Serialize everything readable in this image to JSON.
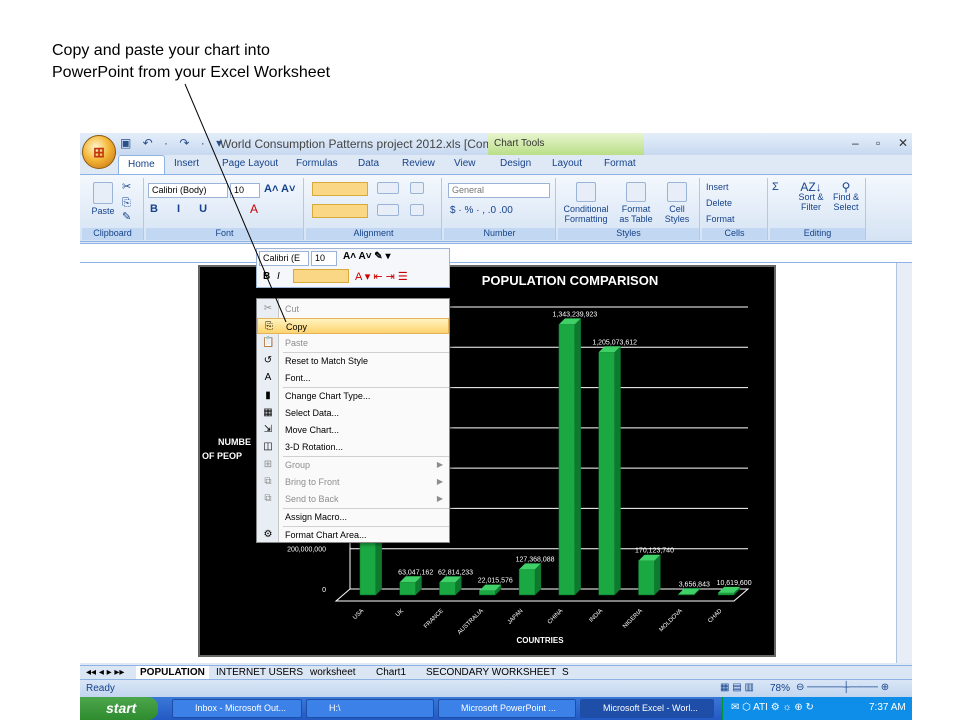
{
  "caption": {
    "line1": "Copy and paste your chart into",
    "line2": "PowerPoint from your Excel Worksheet"
  },
  "title": {
    "qat": "▣ ↶ · ↷ · ▾",
    "window": "World Consumption Patterns project 2012.xls  [Comp...",
    "chart_tools": "Chart Tools",
    "controls": [
      "–",
      "▫",
      "✕"
    ]
  },
  "tabs": [
    "Home",
    "Insert",
    "Page Layout",
    "Formulas",
    "Data",
    "Review",
    "View",
    "Design",
    "Layout",
    "Format"
  ],
  "ribbon": {
    "clipboard": {
      "label": "Clipboard",
      "paste": "Paste"
    },
    "font": {
      "label": "Font",
      "name": "Calibri (Body)",
      "size": "10"
    },
    "alignment": {
      "label": "Alignment"
    },
    "number": {
      "label": "Number",
      "format": "General",
      "symbols": "$ · % · ,  .0 .00"
    },
    "styles": {
      "label": "Styles",
      "conditional": "Conditional Formatting",
      "format_table": "Format as Table",
      "cell_styles": "Cell Styles"
    },
    "cells": {
      "label": "Cells",
      "insert": "Insert",
      "delete": "Delete",
      "format": "Format"
    },
    "editing": {
      "label": "Editing",
      "sort": "Sort & Filter",
      "find": "Find & Select"
    }
  },
  "mini_toolbar": {
    "font": "Calibri (E",
    "size": "10",
    "bold": "B",
    "italic": "I"
  },
  "context_menu": [
    {
      "label": "Cut",
      "icon": "✂",
      "state": "disabled"
    },
    {
      "label": "Copy",
      "icon": "⎘",
      "state": "highlight"
    },
    {
      "label": "Paste",
      "icon": "📋",
      "state": "disabled"
    },
    {
      "label": "Reset to Match Style",
      "icon": "↺",
      "state": ""
    },
    {
      "label": "Font...",
      "icon": "A",
      "state": ""
    },
    {
      "label": "Change Chart Type...",
      "icon": "▮",
      "state": ""
    },
    {
      "label": "Select Data...",
      "icon": "▦",
      "state": ""
    },
    {
      "label": "Move Chart...",
      "icon": "⇲",
      "state": ""
    },
    {
      "label": "3-D Rotation...",
      "icon": "◫",
      "state": ""
    },
    {
      "label": "Group",
      "icon": "⊞",
      "state": "disabled",
      "submenu": true
    },
    {
      "label": "Bring to Front",
      "icon": "⧉",
      "state": "disabled",
      "submenu": true
    },
    {
      "label": "Send to Back",
      "icon": "⧉",
      "state": "disabled",
      "submenu": true
    },
    {
      "label": "Assign Macro...",
      "icon": "",
      "state": ""
    },
    {
      "label": "Format Chart Area...",
      "icon": "⚙",
      "state": ""
    }
  ],
  "chart_data": {
    "type": "bar",
    "title": "POPULATION COMPARISON",
    "xlabel": "COUNTRIES",
    "ylabel": "NUMBE\nOF PEOP",
    "categories": [
      "USA",
      "UK",
      "FRANCE",
      "AUSTRALIA",
      "JAPAN",
      "CHINA",
      "INDIA",
      "NIGERIA",
      "MOLDOVA",
      "CHAD"
    ],
    "values": [
      307212123,
      63047162,
      62814233,
      22015576,
      127368088,
      1343239923,
      1205073612,
      170123740,
      3656843,
      10619600
    ],
    "value_labels": [
      "",
      "63,047,162",
      "62,814,233",
      "22,015,576",
      "127,368,088",
      "1,343,239,923",
      "1,205,073,612",
      "170,123,740",
      "3,656,843",
      "10,619,600"
    ],
    "ytick_labels": [
      "200,000,000",
      "0"
    ],
    "ylim": [
      0,
      1400000000
    ],
    "series_color": "#1aa842",
    "grid": true,
    "legend": "none"
  },
  "sheet_tabs": [
    "POPULATION",
    "INTERNET USERS",
    "worksheet",
    "Chart1",
    "SECONDARY WORKSHEET",
    "S"
  ],
  "status": {
    "ready": "Ready",
    "zoom": "78%"
  },
  "taskbar": {
    "start": "start",
    "buttons": [
      "Inbox - Microsoft Out...",
      "H:\\",
      "Microsoft PowerPoint ...",
      "Microsoft Excel - Worl..."
    ],
    "time": "7:37 AM"
  }
}
